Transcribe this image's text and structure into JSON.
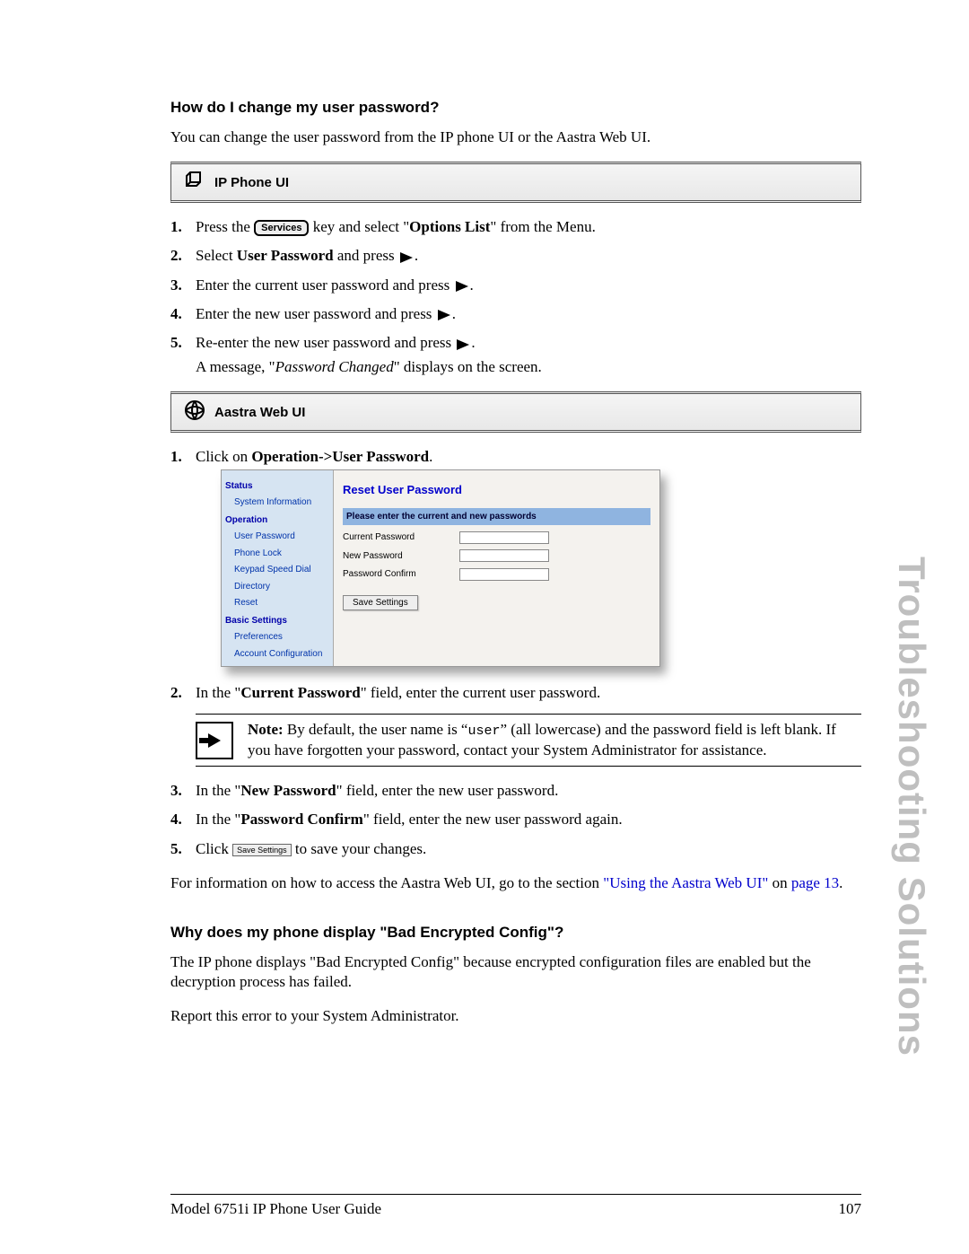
{
  "section1": {
    "heading": "How do I change my user password?",
    "intro": "You can change the user password from the IP phone UI or the Aastra Web UI."
  },
  "ip_bar_label": "IP Phone UI",
  "ip_steps": {
    "s1_a": "Press the",
    "s1_btn": "Services",
    "s1_b": "key and select \"",
    "s1_bold": "Options List",
    "s1_c": "\" from the Menu.",
    "s2_a": "Select ",
    "s2_bold": "User Password",
    "s2_b": " and press ",
    "s3": "Enter the current user password and press ",
    "s4": "Enter the new user password and press ",
    "s5_a": "Re-enter the new user password and press ",
    "s5_b": "A message, \"",
    "s5_i": "Password Changed",
    "s5_c": "\" displays on the screen."
  },
  "web_bar_label": "Aastra Web UI",
  "web_steps": {
    "s1_a": "Click on ",
    "s1_bold": "Operation->User Password",
    "s1_c": ".",
    "s2_a": "In the \"",
    "s2_bold": "Current Password",
    "s2_b": "\" field, enter the current user password.",
    "s3_a": "In the \"",
    "s3_bold": "New Password",
    "s3_b": "\" field, enter the new user password.",
    "s4_a": "In the \"",
    "s4_bold": "Password Confirm",
    "s4_b": "\" field, enter the new user password again.",
    "s5_a": "Click ",
    "s5_btn": "Save Settings",
    "s5_b": " to save your changes."
  },
  "webui": {
    "groups": {
      "status": "Status",
      "status_item": "System Information",
      "operation": "Operation",
      "op_items": [
        "User Password",
        "Phone Lock",
        "Keypad Speed Dial",
        "Directory",
        "Reset"
      ],
      "basic": "Basic Settings",
      "basic_items": [
        "Preferences",
        "Account Configuration"
      ]
    },
    "title": "Reset User Password",
    "banner": "Please enter the current and new passwords",
    "rows": [
      "Current Password",
      "New Password",
      "Password Confirm"
    ],
    "save": "Save Settings"
  },
  "note": {
    "lead": "Note:",
    "body_a": " By default, the user name is “",
    "mono": "user",
    "body_b": "” (all lowercase) and the password field is left blank. If you have forgotten your password, contact your System Administrator for assistance."
  },
  "para_after": {
    "a": "For information on how to access the Aastra Web UI, go to the section ",
    "link1": "\"Using the Aastra Web UI\"",
    "b": " on ",
    "link2": "page 13",
    "c": "."
  },
  "section2": {
    "heading": "Why does my phone display \"Bad Encrypted Config\"?",
    "p1": "The IP phone displays \"Bad Encrypted Config\" because encrypted configuration files are enabled but the decryption process has failed.",
    "p2": "Report this error to your System Administrator."
  },
  "side_title": "Troubleshooting Solutions",
  "footer": {
    "left": "Model 6751i IP Phone User Guide",
    "right": "107"
  }
}
